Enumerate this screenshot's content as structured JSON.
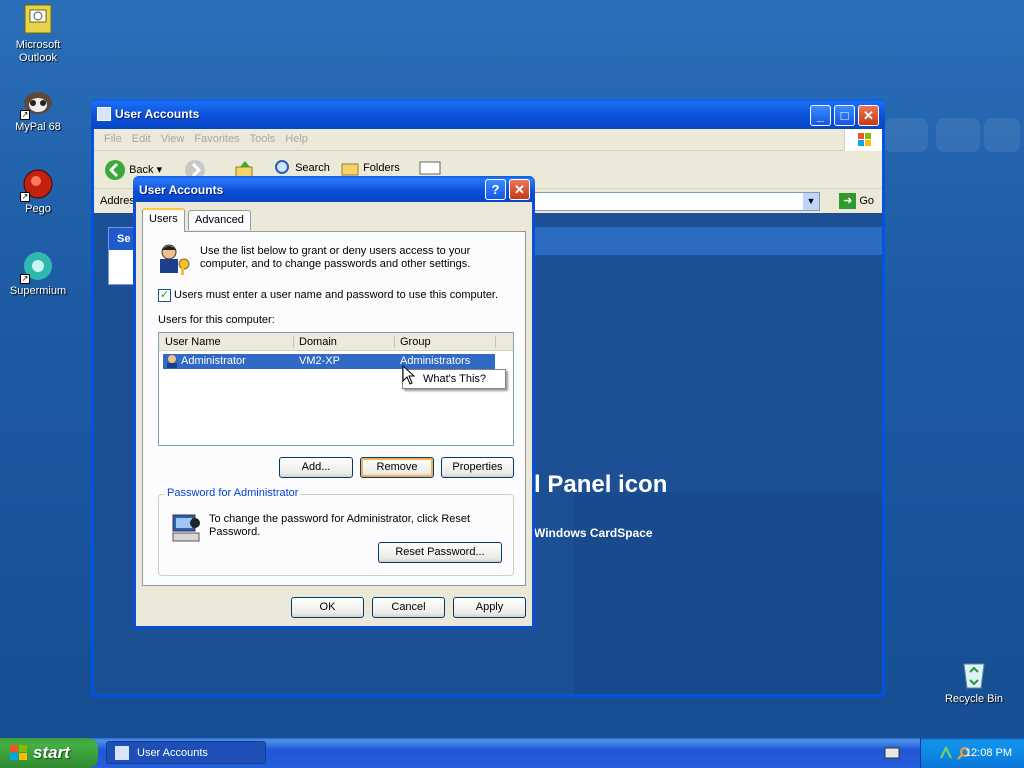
{
  "desktop": {
    "icons": [
      {
        "label": "Microsoft Outlook",
        "icon": "outlook-icon"
      },
      {
        "label": "MyPal 68",
        "icon": "mypal-icon"
      },
      {
        "label": "Pego",
        "icon": "pego-icon"
      },
      {
        "label": "Supermium",
        "icon": "supermium-icon"
      },
      {
        "label": "Recycle Bin",
        "icon": "recycle-bin-icon"
      }
    ]
  },
  "explorer": {
    "title": "User Accounts",
    "menu": [
      "File",
      "Edit",
      "View",
      "Favorites",
      "Tools",
      "Help"
    ],
    "toolbar": {
      "back": "Back",
      "search": "Search",
      "folders": "Folders"
    },
    "address_label": "Address",
    "address_value": "",
    "go_label": "Go",
    "left_pane_header": "Se",
    "headline": "l Panel icon",
    "subline": "Windows CardSpace"
  },
  "dialog": {
    "title": "User Accounts",
    "tabs": [
      "Users",
      "Advanced"
    ],
    "intro": "Use the list below to grant or deny users access to your computer, and to change passwords and other settings.",
    "checkbox_label": "Users must enter a user name and password to use this computer.",
    "checkbox_checked": true,
    "users_label": "Users for this computer:",
    "columns": [
      "User Name",
      "Domain",
      "Group"
    ],
    "rows": [
      {
        "user": "Administrator",
        "domain": "VM2-XP",
        "group": "Administrators"
      }
    ],
    "context_menu": "What's This?",
    "add_label": "Add...",
    "remove_label": "Remove",
    "properties_label": "Properties",
    "password_group_label": "Password for Administrator",
    "password_text": "To change the password for Administrator, click Reset Password.",
    "reset_label": "Reset Password...",
    "ok_label": "OK",
    "cancel_label": "Cancel",
    "apply_label": "Apply"
  },
  "taskbar": {
    "start_label": "start",
    "task_label": "User Accounts",
    "clock": "12:08 PM"
  },
  "colors": {
    "title_blue": "#0a4fd6",
    "selection": "#316ac5",
    "desktop": "#1d5aa3"
  }
}
